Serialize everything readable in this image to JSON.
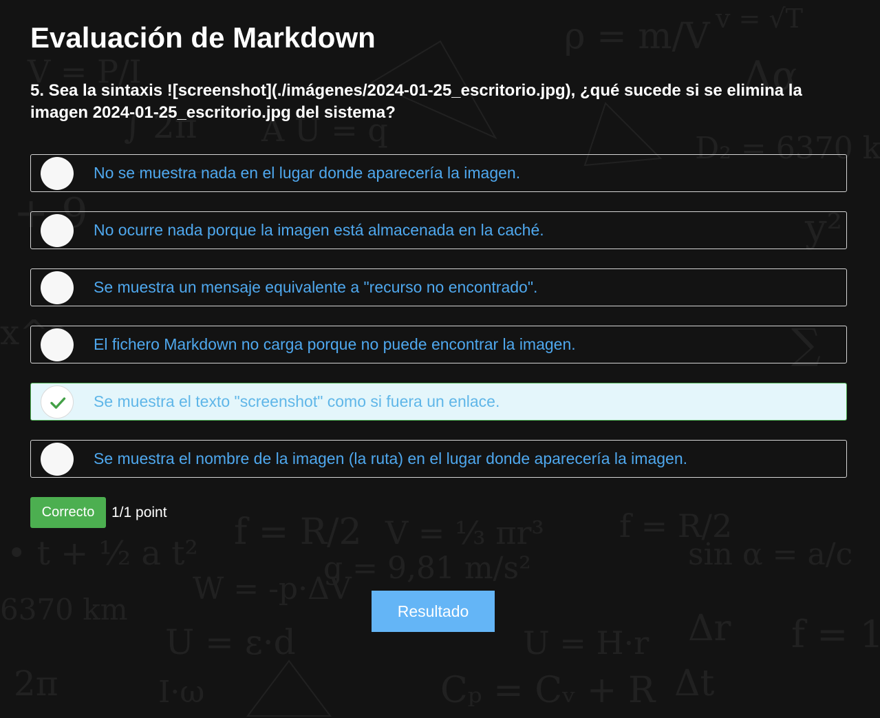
{
  "quiz": {
    "title": "Evaluación de Markdown",
    "question": "5. Sea la sintaxis ![screenshot](./imágenes/2024-01-25_escritorio.jpg), ¿qué sucede si se elimina la imagen 2024-01-25_escritorio.jpg del sistema?"
  },
  "options": [
    {
      "label": "No se muestra nada en el lugar donde aparecería la imagen.",
      "selected": false,
      "correct": false
    },
    {
      "label": "No ocurre nada porque la imagen está almacenada en la caché.",
      "selected": false,
      "correct": false
    },
    {
      "label": "Se muestra un mensaje equivalente a \"recurso no encontrado\".",
      "selected": false,
      "correct": false
    },
    {
      "label": "El fichero Markdown no carga porque no puede encontrar la imagen.",
      "selected": false,
      "correct": false
    },
    {
      "label": "Se muestra el texto \"screenshot\" como si fuera un enlace.",
      "selected": true,
      "correct": true
    },
    {
      "label": "Se muestra el nombre de la imagen (la ruta) en el lugar donde aparecería la imagen.",
      "selected": false,
      "correct": false
    }
  ],
  "result": {
    "status_label": "Correcto",
    "score": "1/1 point"
  },
  "actions": {
    "result_button_label": "Resultado"
  },
  "colors": {
    "background": "#131313",
    "option_text": "#4fa8ee",
    "correct_option_bg": "#e4f6fb",
    "correct_badge": "#4caf50",
    "check_mark": "#43a047",
    "result_button": "#64b5f6"
  },
  "icons": {
    "selected_option": "check-icon"
  }
}
